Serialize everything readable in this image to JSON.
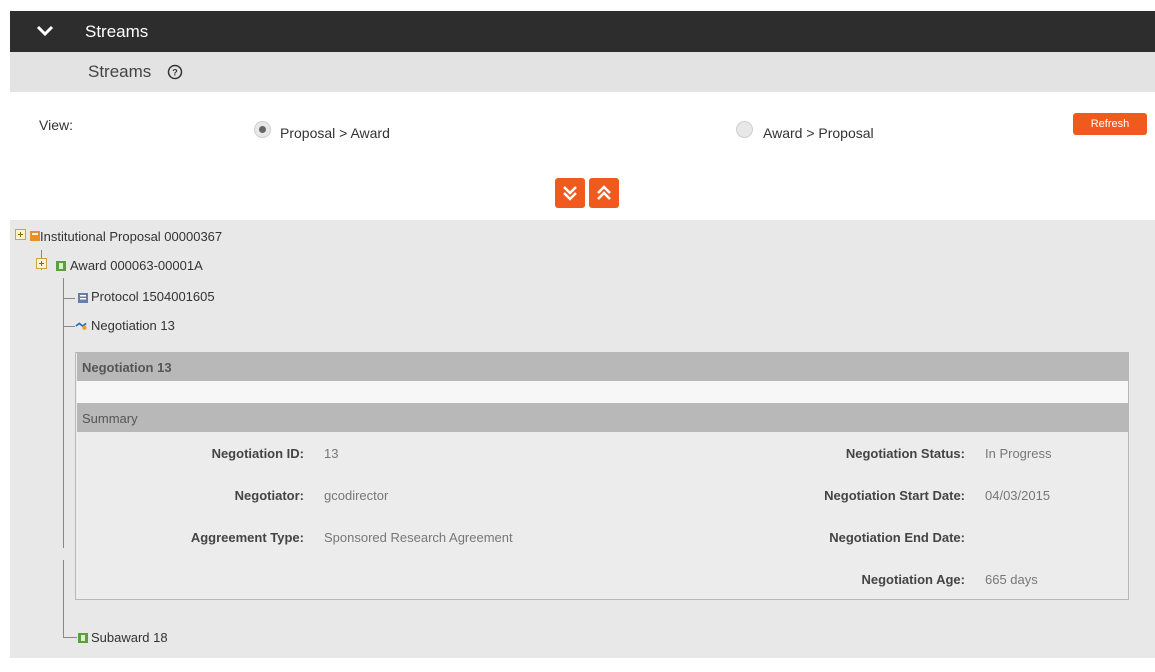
{
  "panel": {
    "title": "Streams",
    "subtitle": "Streams"
  },
  "view": {
    "label": "View:",
    "options": [
      {
        "label": "Proposal > Award",
        "checked": true
      },
      {
        "label": "Award > Proposal",
        "checked": false
      }
    ],
    "refresh_label": "Refresh"
  },
  "tree": {
    "root": "Institutional Proposal 00000367",
    "award": "Award 000063-00001A",
    "protocol": "Protocol 1504001605",
    "negotiation": "Negotiation 13",
    "subaward": "Subaward 18"
  },
  "negotiation_detail": {
    "title": "Negotiation 13",
    "summary_label": "Summary",
    "left_fields": [
      {
        "label": "Negotiation ID:",
        "value": "13"
      },
      {
        "label": "Negotiator:",
        "value": "gcodirector"
      },
      {
        "label": "Aggreement Type:",
        "value": "Sponsored Research Agreement"
      }
    ],
    "right_fields": [
      {
        "label": "Negotiation Status:",
        "value": "In Progress"
      },
      {
        "label": "Negotiation Start Date:",
        "value": "04/03/2015"
      },
      {
        "label": "Negotiation End Date:",
        "value": ""
      },
      {
        "label": "Negotiation Age:",
        "value": "665 days"
      }
    ]
  },
  "colors": {
    "accent": "#f05a1e",
    "header_bg": "#2d2d2d",
    "section_bg": "#b8b8b8"
  },
  "icons": [
    "chevron-down-icon",
    "help-icon",
    "expand-all-icon",
    "collapse-all-icon",
    "plus-box-icon",
    "proposal-icon",
    "award-icon",
    "protocol-icon",
    "negotiation-icon",
    "subaward-icon"
  ]
}
